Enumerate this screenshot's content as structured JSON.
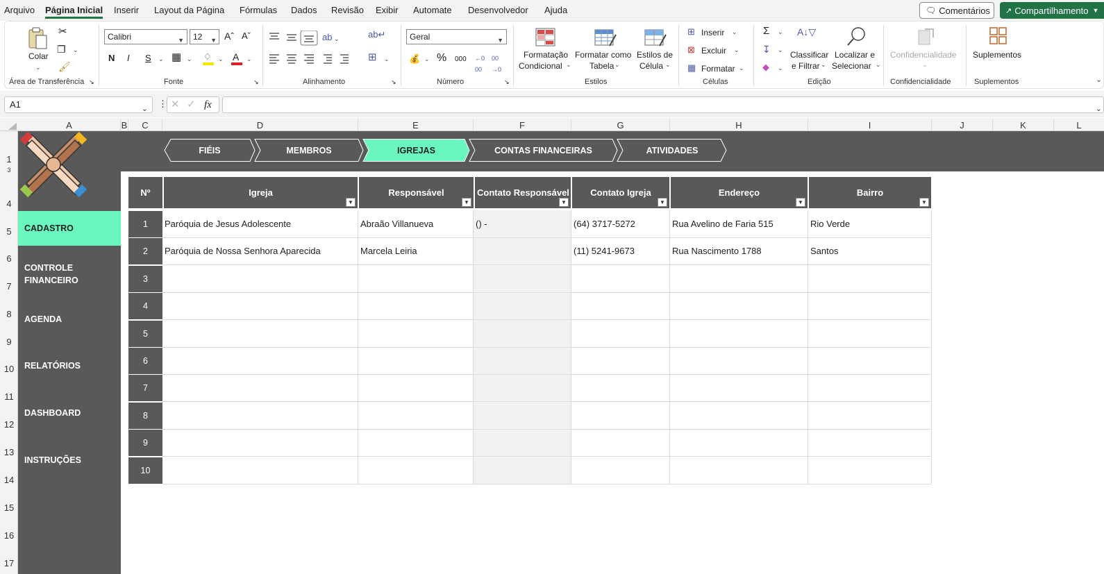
{
  "menu": {
    "items": [
      "Arquivo",
      "Página Inicial",
      "Inserir",
      "Layout da Página",
      "Fórmulas",
      "Dados",
      "Revisão",
      "Exibir",
      "Automate",
      "Desenvolvedor",
      "Ajuda"
    ],
    "comments_label": "Comentários",
    "share_label": "Compartilhamento"
  },
  "ribbon": {
    "clipboard": {
      "paste_label": "Colar",
      "group_label": "Área de Transferência"
    },
    "font": {
      "font_name": "Calibri",
      "font_size": "12",
      "bold": "N",
      "italic": "I",
      "underline": "S",
      "group_label": "Fonte"
    },
    "alignment": {
      "group_label": "Alinhamento"
    },
    "number": {
      "format": "Geral",
      "group_label": "Número"
    },
    "styles": {
      "conditional_line1": "Formatação",
      "conditional_line2": "Condicional",
      "table_line1": "Formatar como",
      "table_line2": "Tabela",
      "cell_line1": "Estilos de",
      "cell_line2": "Célula",
      "group_label": "Estilos"
    },
    "cells": {
      "insert": "Inserir",
      "delete": "Excluir",
      "format": "Formatar",
      "group_label": "Células"
    },
    "editing": {
      "sort_line1": "Classificar",
      "sort_line2": "e Filtrar",
      "find_line1": "Localizar e",
      "find_line2": "Selecionar",
      "group_label": "Edição"
    },
    "sensitivity": {
      "button": "Confidencialidade",
      "group_label": "Confidencialidade"
    },
    "addins": {
      "button": "Suplementos",
      "group_label": "Suplementos"
    }
  },
  "formula_bar": {
    "name_box": "A1",
    "fx": "fx",
    "formula": ""
  },
  "columns": [
    "A",
    "B",
    "C",
    "D",
    "E",
    "F",
    "G",
    "H",
    "I",
    "J",
    "K",
    "L"
  ],
  "rows": [
    "1",
    "3",
    "4",
    "5",
    "6",
    "7",
    "8",
    "9",
    "10",
    "11",
    "12",
    "13",
    "14",
    "15",
    "16",
    "17"
  ],
  "nav_tabs": [
    "FIÉIS",
    "MEMBROS",
    "IGREJAS",
    "CONTAS FINANCEIRAS",
    "ATIVIDADES"
  ],
  "active_tab": "IGREJAS",
  "sidebar": [
    "CADASTRO",
    "CONTROLE FINANCEIRO",
    "AGENDA",
    "RELATÓRIOS",
    "DASHBOARD",
    "INSTRUÇÕES"
  ],
  "active_sidebar": "CADASTRO",
  "colors": {
    "accent": "#6bf5bf",
    "dark": "#595959",
    "excel_green": "#217346"
  },
  "table": {
    "headers": [
      "Nº",
      "Igreja",
      "Responsável",
      "Contato Responsável",
      "Contato Igreja",
      "Endereço",
      "Bairro"
    ],
    "row_numbers": [
      "1",
      "2",
      "3",
      "4",
      "5",
      "6",
      "7",
      "8",
      "9",
      "10"
    ],
    "rows": [
      [
        "Paróquia de Jesus Adolescente",
        "Abraão Villanueva",
        "() -",
        "(64) 3717-5272",
        "Rua Avelino de Faria 515",
        "Rio Verde"
      ],
      [
        "Paróquia de Nossa Senhora Aparecida",
        "Marcela Leiria",
        "",
        "(11) 5241-9673",
        "Rua Nascimento 1788",
        "Santos"
      ]
    ]
  }
}
